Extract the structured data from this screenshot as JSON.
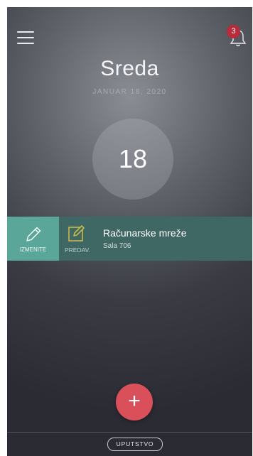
{
  "header": {
    "notifications_count": "3",
    "day_name": "Sreda",
    "date": "JANUAR 18, 2020",
    "day_number": "18"
  },
  "event": {
    "action_label": "IZMENITE",
    "type_label": "PREDAV.",
    "title": "Računarske mreže",
    "room": "Sala 706"
  },
  "footer": {
    "add_label": "+",
    "help_label": "UPUTSTVO"
  },
  "colors": {
    "edit_action": "#5aa698",
    "event_row": "#3f6763",
    "add_button": "#d94f5a",
    "badge": "#b72b3a",
    "type_icon": "#c9b94a"
  }
}
